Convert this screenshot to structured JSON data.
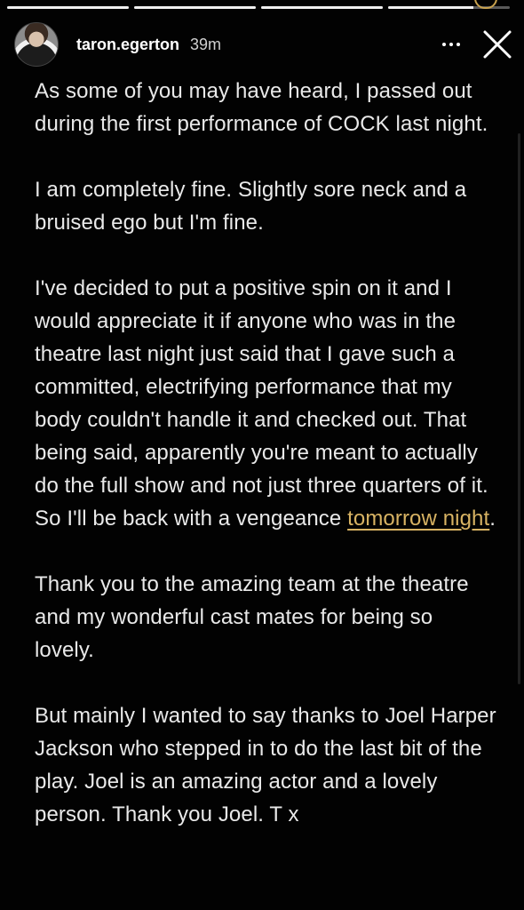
{
  "story": {
    "segments": [
      1.0,
      1.0,
      1.0,
      0.7,
      0.0
    ],
    "corner_mark_color": "#c9a24e"
  },
  "header": {
    "username": "taron.egerton",
    "time": "39m",
    "avatar_icon": "profile-photo",
    "more_icon": "ellipsis-icon",
    "close_icon": "close-icon"
  },
  "post": {
    "p1": "As some of you may have heard, I passed out during the first performance of COCK last night.",
    "p2": "I am completely fine. Slightly sore neck and a bruised ego but I'm fine.",
    "p3_before": "I've decided to put a positive spin on it and I would appreciate it if anyone who was in the theatre last night just said that I gave such a committed, electrifying performance that my body couldn't handle it and checked out. That being said, apparently you're meant to actually do the full show and not just three quarters of it. So I'll be back with a vengeance ",
    "p3_link": "tomorrow night",
    "p3_after": ".",
    "p4": "Thank you to the amazing team at the theatre and my wonderful cast mates for being so lovely.",
    "p5": "But mainly I wanted to say thanks to Joel Harper Jackson who stepped in to do the last bit of the play. Joel is an amazing actor and a lovely person. Thank you Joel. T x",
    "link_color": "#d8b363"
  }
}
